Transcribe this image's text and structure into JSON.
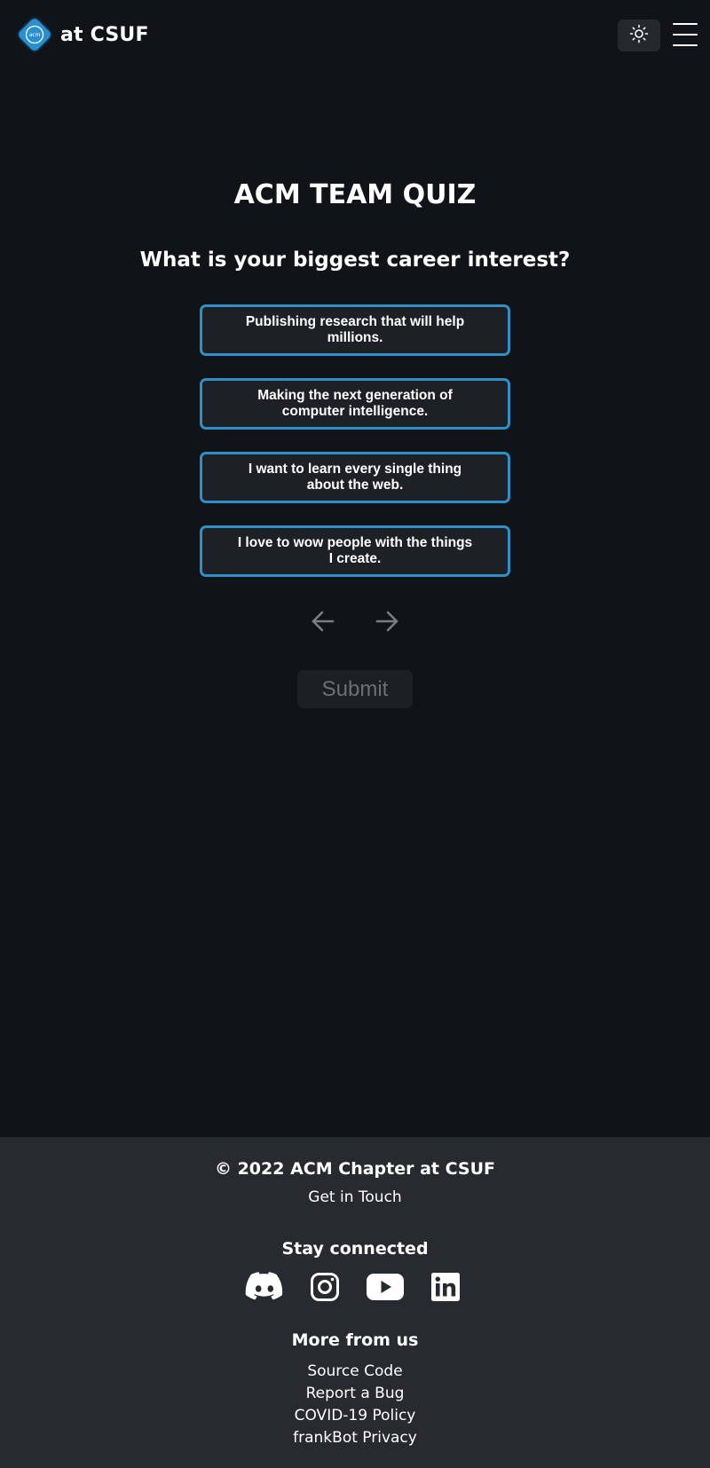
{
  "header": {
    "logo_text": "acm",
    "brand": "at CSUF",
    "theme_icon": "sun-icon",
    "menu_icon": "hamburger-menu-icon"
  },
  "quiz": {
    "title": "ACM TEAM QUIZ",
    "question": "What is your biggest career interest?",
    "answers": [
      "Publishing research that will help millions.",
      "Making the next generation of computer intelligence.",
      "I want to learn every single thing about the web.",
      "I love to wow people with the things I create."
    ],
    "prev_icon": "arrow-left-icon",
    "next_icon": "arrow-right-icon",
    "submit_label": "Submit"
  },
  "footer": {
    "copyright": "© 2022 ACM Chapter at CSUF",
    "get_in_touch": "Get in Touch",
    "stay_connected": "Stay connected",
    "socials": [
      "discord-icon",
      "instagram-icon",
      "youtube-icon",
      "linkedin-icon"
    ],
    "more_from_us": "More from us",
    "links": [
      "Source Code",
      "Report a Bug",
      "COVID-19 Policy",
      "frankBot Privacy"
    ]
  },
  "colors": {
    "background": "#101418",
    "footer_bg": "#272a2e",
    "accent_border": "#2f8fc7",
    "logo_blue": "#2a8fd0"
  }
}
